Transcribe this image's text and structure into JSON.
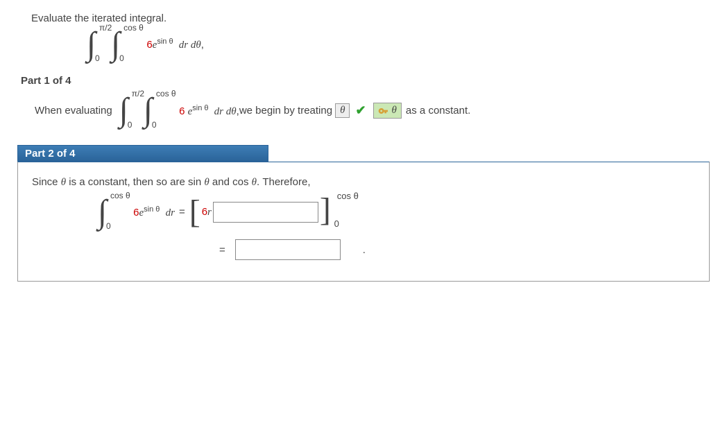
{
  "question": {
    "prompt": "Evaluate the iterated integral.",
    "outer_upper": "π/2",
    "outer_lower": "0",
    "inner_upper": "cos θ",
    "inner_lower": "0",
    "coeff": "6",
    "base": "e",
    "exp": "sin θ",
    "diff": "dr dθ",
    "comma": ","
  },
  "part1": {
    "header": "Part 1 of 4",
    "lead": "When evaluating",
    "outer_upper": "π/2",
    "outer_lower": "0",
    "inner_upper": "cos θ",
    "inner_lower": "0",
    "coeff": "6 ",
    "base": "e",
    "exp": "sin θ",
    "diff": "dr dθ",
    "comma": ",",
    "mid_text": " we begin by treating ",
    "answer_var": "θ",
    "key_val": "θ",
    "tail": " as a constant."
  },
  "part2": {
    "header": "Part 2 of 4",
    "line1a": "Since ",
    "theta": "θ",
    "line1b": " is a constant, then so are sin ",
    "line1c": " and cos ",
    "line1d": ". Therefore,",
    "int_upper": "cos θ",
    "int_lower": "0",
    "coeff": "6",
    "base": "e",
    "exp": "sin θ",
    "diff": "dr",
    "eq": " = ",
    "lbracket": "[",
    "inner_coeff": "6",
    "inner_var": "r",
    "rbracket": "]",
    "br_upper": "cos θ",
    "br_lower": "0",
    "eq2": "=",
    "period": "."
  }
}
